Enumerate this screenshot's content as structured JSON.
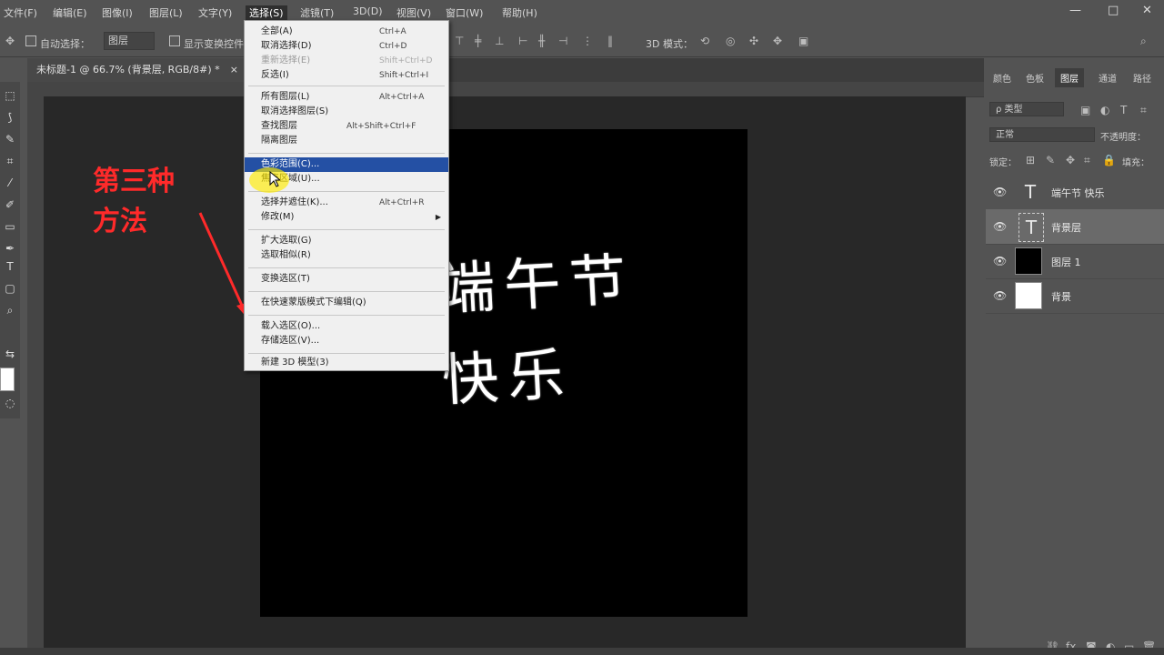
{
  "menubar": {
    "items": [
      "文件(F)",
      "编辑(E)",
      "图像(I)",
      "图层(L)",
      "文字(Y)",
      "选择(S)",
      "滤镜(T)",
      "3D(D)",
      "视图(V)",
      "窗口(W)",
      "帮助(H)"
    ],
    "active_index": 5,
    "window_buttons": [
      "—",
      "□",
      "✕"
    ]
  },
  "options": {
    "auto_select_label": "自动选择：",
    "auto_select_value": "图层",
    "show_transform_label": "显示变换控件",
    "mode_3d_label": "3D 模式："
  },
  "document_tab": {
    "title": "未标题-1 @ 66.7% (背景层, RGB/8#) *",
    "close": "×"
  },
  "annotation": {
    "line1": "第三种",
    "line2": "方法"
  },
  "canvas_text": {
    "line1": "端午节",
    "line2": "快乐"
  },
  "select_menu": {
    "items": [
      {
        "label": "全部(A)",
        "shortcut": "Ctrl+A",
        "state": "normal"
      },
      {
        "label": "取消选择(D)",
        "shortcut": "Ctrl+D",
        "state": "normal"
      },
      {
        "label": "重新选择(E)",
        "shortcut": "Shift+Ctrl+D",
        "state": "disabled"
      },
      {
        "label": "反选(I)",
        "shortcut": "Shift+Ctrl+I",
        "state": "normal"
      },
      {
        "label": "所有图层(L)",
        "shortcut": "Alt+Ctrl+A",
        "state": "normal"
      },
      {
        "label": "取消选择图层(S)",
        "shortcut": "",
        "state": "normal"
      },
      {
        "label": "查找图层",
        "shortcut": "Alt+Shift+Ctrl+F",
        "state": "normal"
      },
      {
        "label": "隔离图层",
        "shortcut": "",
        "state": "normal"
      },
      {
        "label": "色彩范围(C)...",
        "shortcut": "",
        "state": "selected"
      },
      {
        "label": "焦点区域(U)...",
        "shortcut": "",
        "state": "normal"
      },
      {
        "label": "选择并遮住(K)...",
        "shortcut": "Alt+Ctrl+R",
        "state": "normal"
      },
      {
        "label": "修改(M)",
        "shortcut": "",
        "state": "submenu"
      },
      {
        "label": "扩大选取(G)",
        "shortcut": "",
        "state": "normal"
      },
      {
        "label": "选取相似(R)",
        "shortcut": "",
        "state": "normal"
      },
      {
        "label": "变换选区(T)",
        "shortcut": "",
        "state": "normal"
      },
      {
        "label": "在快速蒙版模式下编辑(Q)",
        "shortcut": "",
        "state": "normal"
      },
      {
        "label": "载入选区(O)...",
        "shortcut": "",
        "state": "normal"
      },
      {
        "label": "存储选区(V)...",
        "shortcut": "",
        "state": "normal"
      },
      {
        "label": "新建 3D 模型(3)",
        "shortcut": "",
        "state": "normal"
      }
    ],
    "submenu_arrow": "▶"
  },
  "panels": {
    "tabs": [
      "颜色",
      "色板",
      "图层",
      "通道",
      "路径"
    ],
    "active_tab_index": 2,
    "filter_label": "ρ 类型",
    "blend_mode": "正常",
    "opacity_label": "不透明度：",
    "lock_label": "锁定：",
    "fill_label": "填充："
  },
  "layers": [
    {
      "name": "端午节 快乐",
      "kind": "text",
      "visible_icon": "👁",
      "thumb_glyph": "T",
      "selected": false
    },
    {
      "name": "背景层",
      "kind": "text",
      "visible_icon": "👁",
      "thumb_glyph": "T",
      "selected": true
    },
    {
      "name": "图层 1",
      "kind": "pixel",
      "visible_icon": "👁",
      "thumb_color": "#000000",
      "selected": false
    },
    {
      "name": "背景",
      "kind": "pixel",
      "visible_icon": "👁",
      "thumb_color": "#ffffff",
      "selected": false
    }
  ],
  "colors": {
    "menu_selected": "#2450a4",
    "annotation": "#ff2a2a",
    "highlight": "#ffeb00"
  }
}
